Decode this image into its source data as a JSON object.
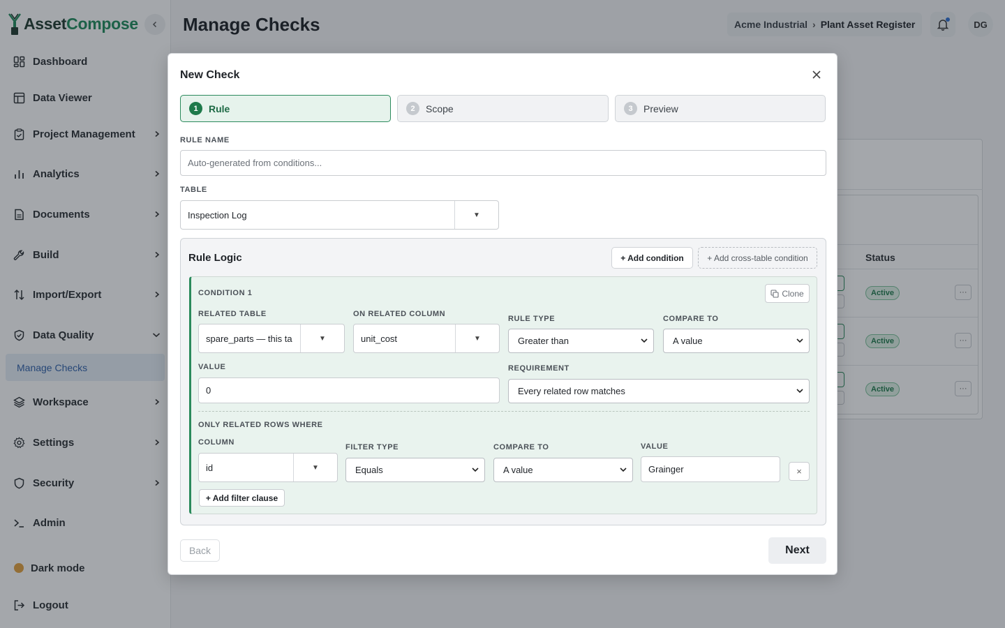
{
  "app": {
    "brand_a": "Asset",
    "brand_b": "Compose"
  },
  "sidebar": {
    "items": [
      {
        "label": "Dashboard",
        "icon": "dashboard-icon"
      },
      {
        "label": "Data Viewer",
        "icon": "table-icon"
      },
      {
        "label": "Project Management",
        "icon": "clipboard-icon"
      },
      {
        "label": "Analytics",
        "icon": "bar-chart-icon"
      },
      {
        "label": "Documents",
        "icon": "document-icon"
      },
      {
        "label": "Build",
        "icon": "wrench-icon"
      },
      {
        "label": "Import/Export",
        "icon": "arrows-updown-icon"
      },
      {
        "label": "Data Quality",
        "icon": "shield-check-icon"
      },
      {
        "label": "Workspace",
        "icon": "layers-icon"
      },
      {
        "label": "Settings",
        "icon": "gear-icon"
      },
      {
        "label": "Security",
        "icon": "shield-icon"
      },
      {
        "label": "Admin",
        "icon": "terminal-icon"
      }
    ],
    "sub_item": "Manage Checks",
    "dark_mode": "Dark mode",
    "logout": "Logout"
  },
  "header": {
    "title": "Manage Checks",
    "breadcrumb": [
      "Acme Industrial",
      "Plant Asset Register"
    ],
    "avatar_initials": "DG"
  },
  "background_table": {
    "status_header": "Status",
    "rows": [
      {
        "status": "Active"
      },
      {
        "status": "Active"
      },
      {
        "status": "Active"
      }
    ],
    "more_label": "···"
  },
  "modal": {
    "title": "New Check",
    "steps": [
      {
        "num": "1",
        "label": "Rule",
        "active": true
      },
      {
        "num": "2",
        "label": "Scope",
        "active": false
      },
      {
        "num": "3",
        "label": "Preview",
        "active": false
      }
    ],
    "rule_name_label": "RULE NAME",
    "rule_name_placeholder": "Auto-generated from conditions...",
    "table_label": "TABLE",
    "table_value": "Inspection Log",
    "rule_logic_title": "Rule Logic",
    "add_condition": "+ Add condition",
    "add_cross_table": "+ Add cross-table condition",
    "condition": {
      "title": "CONDITION 1",
      "clone": "Clone",
      "related_table_label": "RELATED TABLE",
      "related_table_value": "spare_parts — this ta",
      "related_column_label": "ON RELATED COLUMN",
      "related_column_value": "unit_cost",
      "rule_type_label": "RULE TYPE",
      "rule_type_value": "Greater than",
      "compare_to_label": "COMPARE TO",
      "compare_to_value": "A value",
      "value_label": "VALUE",
      "value_value": "0",
      "requirement_label": "REQUIREMENT",
      "requirement_value": "Every related row matches",
      "filter_section_label": "ONLY RELATED ROWS WHERE",
      "filter": {
        "column_label": "COLUMN",
        "column_value": "id",
        "filter_type_label": "FILTER TYPE",
        "filter_type_value": "Equals",
        "compare_to_label": "COMPARE TO",
        "compare_to_value": "A value",
        "value_label": "VALUE",
        "value_value": "Grainger",
        "remove": "×"
      },
      "add_filter": "+ Add filter clause"
    },
    "back": "Back",
    "next": "Next"
  }
}
